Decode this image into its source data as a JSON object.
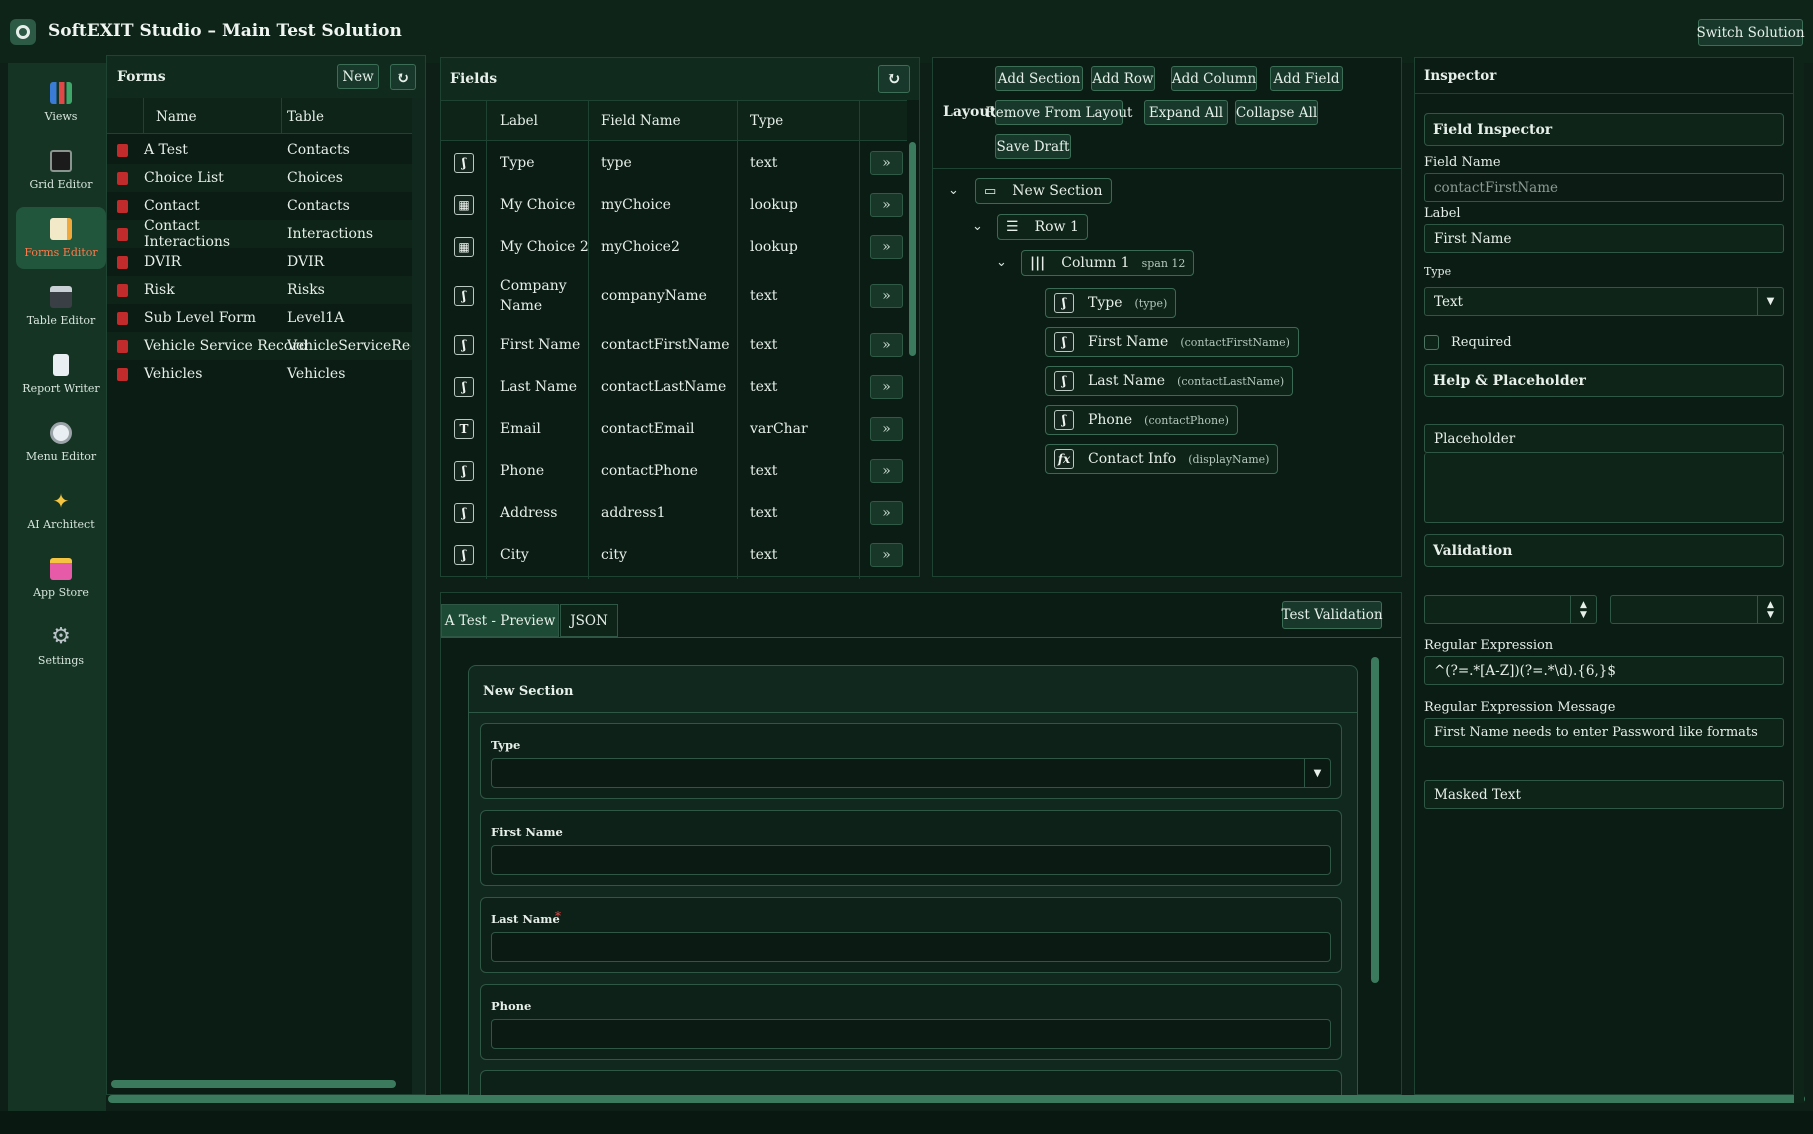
{
  "app": {
    "title": "SoftEXIT Studio – Main Test Solution",
    "switch_label": "Switch Solution"
  },
  "nav": [
    {
      "label": "Views",
      "icon": "chart-icon"
    },
    {
      "label": "Grid Editor",
      "icon": "monitor-icon"
    },
    {
      "label": "Forms Editor",
      "icon": "memo-icon",
      "active": true
    },
    {
      "label": "Table Editor",
      "icon": "floppy-icon"
    },
    {
      "label": "Report Writer",
      "icon": "page-icon"
    },
    {
      "label": "Menu Editor",
      "icon": "compass-icon"
    },
    {
      "label": "AI Architect",
      "icon": "sparkles-icon"
    },
    {
      "label": "App Store",
      "icon": "bag-icon"
    },
    {
      "label": "Settings",
      "icon": "gear-icon"
    }
  ],
  "forms": {
    "title": "Forms",
    "new_label": "New",
    "col_name": "Name",
    "col_table": "Table",
    "rows": [
      {
        "name": "A Test",
        "table": "Contacts"
      },
      {
        "name": "Choice List",
        "table": "Choices"
      },
      {
        "name": "Contact",
        "table": "Contacts"
      },
      {
        "name": "Contact Interactions",
        "table": "Interactions"
      },
      {
        "name": "DVIR",
        "table": "DVIR"
      },
      {
        "name": "Risk",
        "table": "Risks"
      },
      {
        "name": "Sub Level Form",
        "table": "Level1A"
      },
      {
        "name": "Vehicle Service Record",
        "table": "VehicleServiceRecord"
      },
      {
        "name": "Vehicles",
        "table": "Vehicles"
      }
    ]
  },
  "fields": {
    "title": "Fields",
    "col_label": "Label",
    "col_field": "Field Name",
    "col_type": "Type",
    "rows": [
      {
        "label": "Type",
        "field": "type",
        "type": "text",
        "icon": "ʃ"
      },
      {
        "label": "My Choice",
        "field": "myChoice",
        "type": "lookup",
        "icon": "▦"
      },
      {
        "label": "My Choice 2",
        "field": "myChoice2",
        "type": "lookup",
        "icon": "▦"
      },
      {
        "label": "Company Name",
        "field": "companyName",
        "type": "text",
        "icon": "ʃ"
      },
      {
        "label": "First Name",
        "field": "contactFirstName",
        "type": "text",
        "icon": "ʃ"
      },
      {
        "label": "Last Name",
        "field": "contactLastName",
        "type": "text",
        "icon": "ʃ"
      },
      {
        "label": "Email",
        "field": "contactEmail",
        "type": "varChar",
        "icon": "T"
      },
      {
        "label": "Phone",
        "field": "contactPhone",
        "type": "text",
        "icon": "ʃ"
      },
      {
        "label": "Address",
        "field": "address1",
        "type": "text",
        "icon": "ʃ"
      },
      {
        "label": "City",
        "field": "city",
        "type": "text",
        "icon": "ʃ"
      }
    ]
  },
  "layout": {
    "label": "Layout",
    "add_section": "Add Section",
    "add_row": "Add Row",
    "add_column": "Add Column",
    "add_field": "Add Field",
    "remove": "Remove From Layout",
    "expand": "Expand All",
    "collapse": "Collapse All",
    "save": "Save Draft",
    "section": "New Section",
    "row": "Row 1",
    "column": "Column 1",
    "span": "span 12",
    "items": [
      {
        "label": "Type",
        "field": "(type)",
        "icon": "ʃ"
      },
      {
        "label": "First Name",
        "field": "(contactFirstName)",
        "icon": "ʃ"
      },
      {
        "label": "Last Name",
        "field": "(contactLastName)",
        "icon": "ʃ"
      },
      {
        "label": "Phone",
        "field": "(contactPhone)",
        "icon": "ʃ"
      },
      {
        "label": "Contact Info",
        "field": "(displayName)",
        "icon": "fx"
      }
    ]
  },
  "preview": {
    "tab_preview": "A Test - Preview",
    "tab_json": "JSON",
    "test_label": "Test Validation",
    "section": "New Section",
    "fields": [
      {
        "label": "Type",
        "required": false
      },
      {
        "label": "First Name",
        "required": false
      },
      {
        "label": "Last Name",
        "required": true
      },
      {
        "label": "Phone",
        "required": false
      }
    ]
  },
  "inspector": {
    "title": "Inspector",
    "field_inspector": "Field Inspector",
    "field_name_label": "Field Name",
    "field_name_value": "contactFirstName",
    "label_label": "Label",
    "label_value": "First Name",
    "type_label": "Type",
    "type_value": "Text",
    "required_label": "Required",
    "help_section": "Help & Placeholder",
    "placeholder_label": "Placeholder",
    "validation_section": "Validation",
    "regex_label": "Regular Expression",
    "regex_value": "^(?=.*[A-Z])(?=.*\\d).{6,}$",
    "regex_msg_label": "Regular Expression Message",
    "regex_msg_value": "First Name needs to enter Password like formats",
    "masked_label": "Masked Text"
  },
  "colors": {
    "accent": "#ff7a4a",
    "required": "#e04848",
    "trash": "#c22b2b"
  }
}
